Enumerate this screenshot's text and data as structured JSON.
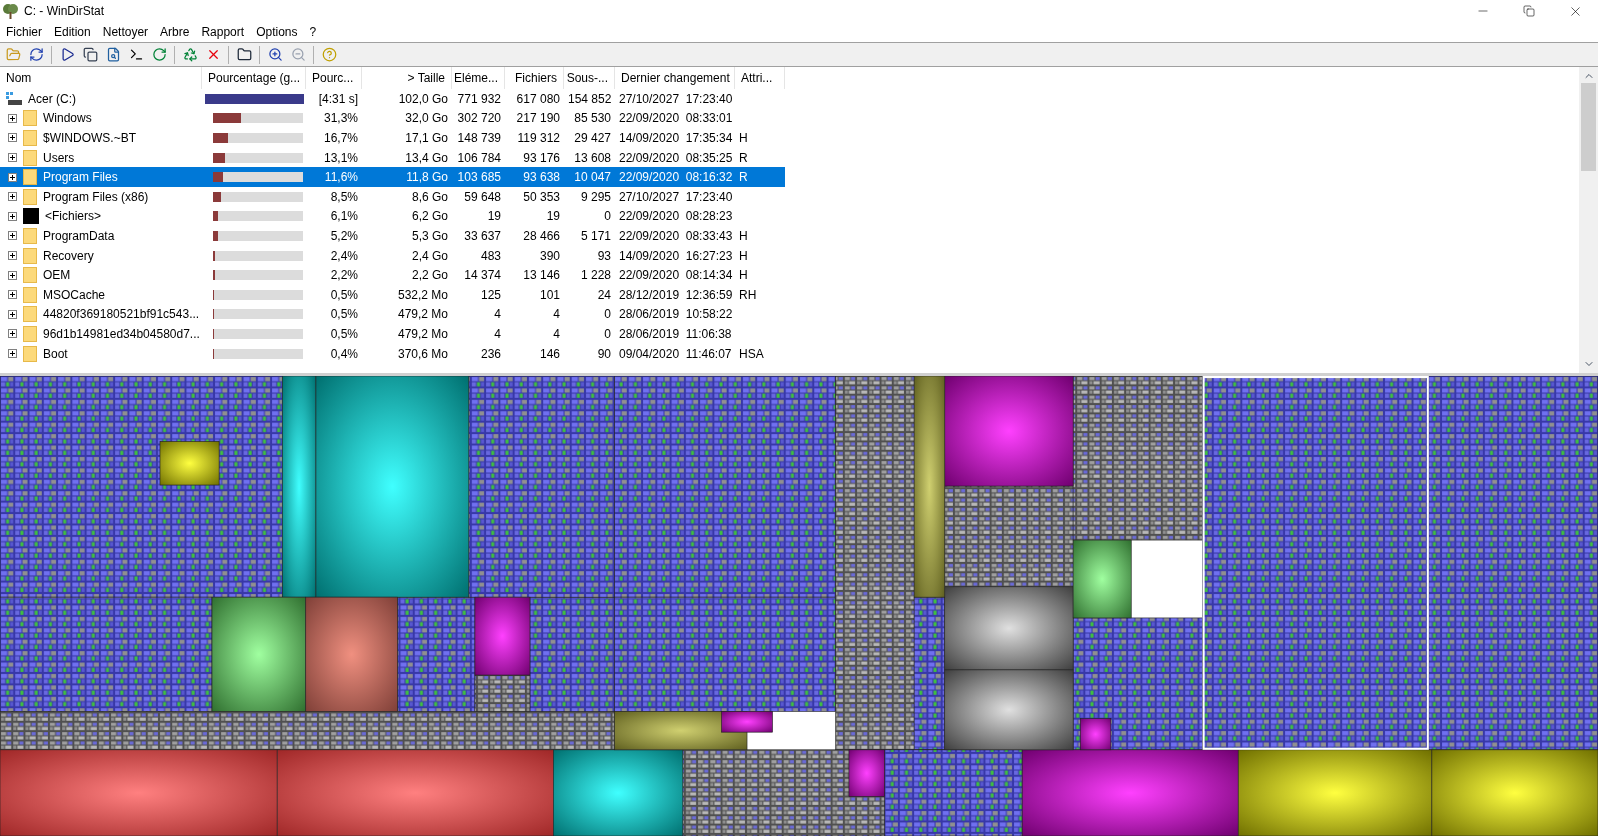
{
  "window": {
    "title": "C: - WinDirStat"
  },
  "menu": [
    "Fichier",
    "Edition",
    "Nettoyer",
    "Arbre",
    "Rapport",
    "Options",
    "?"
  ],
  "table": {
    "columns": [
      "Nom",
      "Pourcentage (g...",
      "Pourc...",
      "> Taille",
      "Eléme...",
      "Fichiers",
      "Sous-...",
      "Dernier changement",
      "Attri..."
    ],
    "rows": [
      {
        "kind": "drive",
        "name": "Acer (C:)",
        "level": 1,
        "percent": "[4:31 s]",
        "size": "102,0 Go",
        "items": "771 932",
        "files": "617 080",
        "subdirs": "154 852",
        "modified": "27/10/2027  17:23:40",
        "selected": false,
        "children": [
          {
            "kind": "folder",
            "name": "Windows",
            "level": 0.313,
            "percent": "31,3%",
            "size": "32,0 Go",
            "items": "302 720",
            "files": "217 190",
            "subdirs": "85 530",
            "modified": "22/09/2020  08:33:01",
            "selected": false
          },
          {
            "kind": "folder",
            "name": "$WINDOWS.~BT",
            "level": 0.167,
            "percent": "16,7%",
            "size": "17,1 Go",
            "items": "148 739",
            "files": "119 312",
            "subdirs": "29 427",
            "modified": "14/09/2020  17:35:34",
            "attributes": "H",
            "selected": false
          },
          {
            "kind": "folder",
            "name": "Users",
            "level": 0.131,
            "percent": "13,1%",
            "size": "13,4 Go",
            "items": "106 784",
            "files": "93 176",
            "subdirs": "13 608",
            "modified": "22/09/2020  08:35:25",
            "attributes": "R",
            "selected": false
          },
          {
            "kind": "folder",
            "name": "Program Files",
            "level": 0.116,
            "percent": "11,6%",
            "size": "11,8 Go",
            "items": "103 685",
            "files": "93 638",
            "subdirs": "10 047",
            "modified": "22/09/2020  08:16:32",
            "attributes": "R",
            "selected": true
          },
          {
            "kind": "folder",
            "name": "Program Files (x86)",
            "level": 0.085,
            "percent": "8,5%",
            "size": "8,6 Go",
            "items": "59 648",
            "files": "50 353",
            "subdirs": "9 295",
            "modified": "27/10/2027  17:23:40",
            "selected": false
          },
          {
            "kind": "files",
            "name": "<Fichiers>",
            "level": 0.061,
            "percent": "6,1%",
            "size": "6,2 Go",
            "items": "19",
            "files": "19",
            "subdirs": "0",
            "modified": "22/09/2020  08:28:23",
            "selected": false
          },
          {
            "kind": "folder",
            "name": "ProgramData",
            "level": 0.052,
            "percent": "5,2%",
            "size": "5,3 Go",
            "items": "33 637",
            "files": "28 466",
            "subdirs": "5 171",
            "modified": "22/09/2020  08:33:43",
            "attributes": "H",
            "selected": false
          },
          {
            "kind": "folder",
            "name": "Recovery",
            "level": 0.024,
            "percent": "2,4%",
            "size": "2,4 Go",
            "items": "483",
            "files": "390",
            "subdirs": "93",
            "modified": "14/09/2020  16:27:23",
            "attributes": "H",
            "selected": false
          },
          {
            "kind": "folder",
            "name": "OEM",
            "level": 0.022,
            "percent": "2,2%",
            "size": "2,2 Go",
            "items": "14 374",
            "files": "13 146",
            "subdirs": "1 228",
            "modified": "22/09/2020  08:14:34",
            "attributes": "H",
            "selected": false
          },
          {
            "kind": "folder",
            "name": "MSOCache",
            "level": 0.005,
            "percent": "0,5%",
            "size": "532,2 Mo",
            "items": "125",
            "files": "101",
            "subdirs": "24",
            "modified": "28/12/2019  12:36:59",
            "attributes": "RH",
            "selected": false
          },
          {
            "kind": "folder",
            "name": "44820f369180521bf91c543...",
            "level": 0.005,
            "percent": "0,5%",
            "size": "479,2 Mo",
            "items": "4",
            "files": "4",
            "subdirs": "0",
            "modified": "28/06/2019  10:58:22",
            "selected": false
          },
          {
            "kind": "folder",
            "name": "96d1b14981ed34b04580d7...",
            "level": 0.005,
            "percent": "0,5%",
            "size": "479,2 Mo",
            "items": "4",
            "files": "4",
            "subdirs": "0",
            "modified": "28/06/2019  11:06:38",
            "selected": false
          },
          {
            "kind": "folder",
            "name": "Boot",
            "level": 0.004,
            "percent": "0,4%",
            "size": "370,6 Mo",
            "items": "236",
            "files": "146",
            "subdirs": "90",
            "modified": "09/04/2020  11:46:07",
            "attributes": "HSA",
            "selected": false
          }
        ]
      }
    ]
  }
}
